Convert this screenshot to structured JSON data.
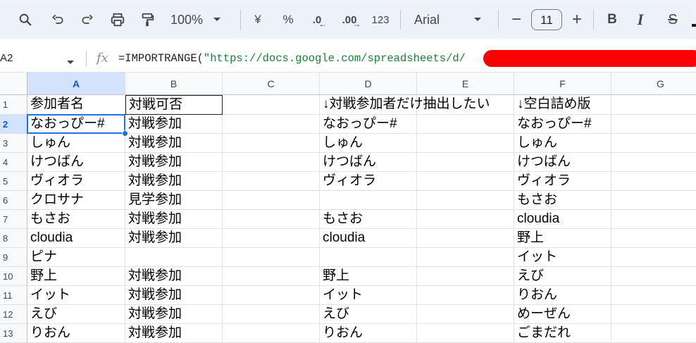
{
  "toolbar": {
    "zoom": "100%",
    "currency": "¥",
    "percent": "%",
    "dec_decrease": ".0",
    "dec_increase": ".00",
    "number_format": "123",
    "font": "Arial",
    "font_size": "11",
    "minus": "−",
    "plus": "+",
    "bold": "B",
    "italic": "I",
    "strike": "S"
  },
  "formula_bar": {
    "cell_ref": "A2",
    "fx": "fx",
    "formula_prefix": "=IMPORTRANGE(",
    "formula_string": "\"https://docs.google.com/spreadsheets/d/"
  },
  "sheet": {
    "columns": [
      "A",
      "B",
      "C",
      "D",
      "E",
      "F",
      "G"
    ],
    "selected_column": "A",
    "selected_row": "2",
    "rows": [
      {
        "n": "1",
        "a": "参加者名",
        "b": "対戦可否",
        "c": "",
        "d": "↓対戦参加者だけ抽出したい",
        "e": "",
        "f": "↓空白詰め版",
        "g": ""
      },
      {
        "n": "2",
        "a": "なおっぴー#",
        "b": "対戦参加",
        "c": "",
        "d": "なおっぴー#",
        "e": "",
        "f": "なおっぴー#",
        "g": ""
      },
      {
        "n": "3",
        "a": "しゅん",
        "b": "対戦参加",
        "c": "",
        "d": "しゅん",
        "e": "",
        "f": "しゅん",
        "g": ""
      },
      {
        "n": "4",
        "a": "けつばん",
        "b": "対戦参加",
        "c": "",
        "d": "けつばん",
        "e": "",
        "f": "けつばん",
        "g": ""
      },
      {
        "n": "5",
        "a": "ヴィオラ",
        "b": "対戦参加",
        "c": "",
        "d": "ヴィオラ",
        "e": "",
        "f": "ヴィオラ",
        "g": ""
      },
      {
        "n": "6",
        "a": "クロサナ",
        "b": "見学参加",
        "c": "",
        "d": "",
        "e": "",
        "f": "もさお",
        "g": ""
      },
      {
        "n": "7",
        "a": "もさお",
        "b": "対戦参加",
        "c": "",
        "d": "もさお",
        "e": "",
        "f": "cloudia",
        "g": ""
      },
      {
        "n": "8",
        "a": "cloudia",
        "b": "対戦参加",
        "c": "",
        "d": "cloudia",
        "e": "",
        "f": "野上",
        "g": ""
      },
      {
        "n": "9",
        "a": "ピナ",
        "b": "",
        "c": "",
        "d": "",
        "e": "",
        "f": "イット",
        "g": ""
      },
      {
        "n": "10",
        "a": "野上",
        "b": "対戦参加",
        "c": "",
        "d": "野上",
        "e": "",
        "f": "えび",
        "g": ""
      },
      {
        "n": "11",
        "a": "イット",
        "b": "対戦参加",
        "c": "",
        "d": "イット",
        "e": "",
        "f": "りおん",
        "g": ""
      },
      {
        "n": "12",
        "a": "えび",
        "b": "対戦参加",
        "c": "",
        "d": "えび",
        "e": "",
        "f": "めーぜん",
        "g": ""
      },
      {
        "n": "13",
        "a": "りおん",
        "b": "対戦参加",
        "c": "",
        "d": "りおん",
        "e": "",
        "f": "ごまだれ",
        "g": ""
      }
    ]
  }
}
